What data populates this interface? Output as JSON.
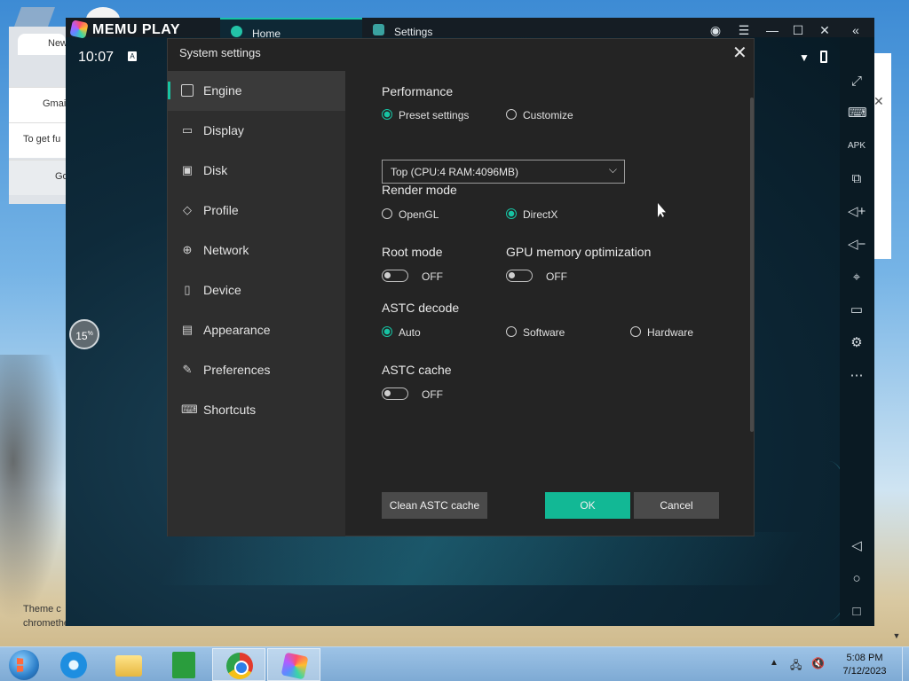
{
  "memu": {
    "brand": "MEMU PLAY",
    "tabs": [
      {
        "label": "Home"
      },
      {
        "label": "Settings"
      }
    ],
    "android": {
      "time": "10:07",
      "progress": "15",
      "progress_unit": "%"
    }
  },
  "chrome_bg": {
    "tab_label": "New",
    "gmail": "Gmai",
    "hint": "To get fu",
    "google": "Go",
    "theme": "Theme c",
    "credit": "chromethemer.com"
  },
  "dialog": {
    "title": "System settings",
    "nav": [
      {
        "label": "Engine",
        "icon": "chip-icon"
      },
      {
        "label": "Display",
        "icon": "monitor-icon"
      },
      {
        "label": "Disk",
        "icon": "disk-icon"
      },
      {
        "label": "Profile",
        "icon": "tag-icon"
      },
      {
        "label": "Network",
        "icon": "globe-icon"
      },
      {
        "label": "Device",
        "icon": "phone-icon"
      },
      {
        "label": "Appearance",
        "icon": "window-icon"
      },
      {
        "label": "Preferences",
        "icon": "wrench-icon"
      },
      {
        "label": "Shortcuts",
        "icon": "keyboard-icon"
      }
    ],
    "performance": {
      "label": "Performance",
      "preset": "Preset settings",
      "customize": "Customize",
      "selected": "Preset settings",
      "dropdown_value": "Top (CPU:4 RAM:4096MB)"
    },
    "render_mode": {
      "label": "Render mode",
      "opengl": "OpenGL",
      "directx": "DirectX",
      "selected": "DirectX"
    },
    "root_mode": {
      "label": "Root mode",
      "state": "OFF"
    },
    "gpu_mem": {
      "label": "GPU memory optimization",
      "state": "OFF"
    },
    "astc_decode": {
      "label": "ASTC decode",
      "auto": "Auto",
      "software": "Software",
      "hardware": "Hardware",
      "selected": "Auto"
    },
    "astc_cache": {
      "label": "ASTC cache",
      "state": "OFF"
    },
    "buttons": {
      "clean": "Clean ASTC cache",
      "ok": "OK",
      "cancel": "Cancel"
    },
    "accent_color": "#17c3a3"
  },
  "taskbar": {
    "time": "5:08 PM",
    "date": "7/12/2023"
  }
}
